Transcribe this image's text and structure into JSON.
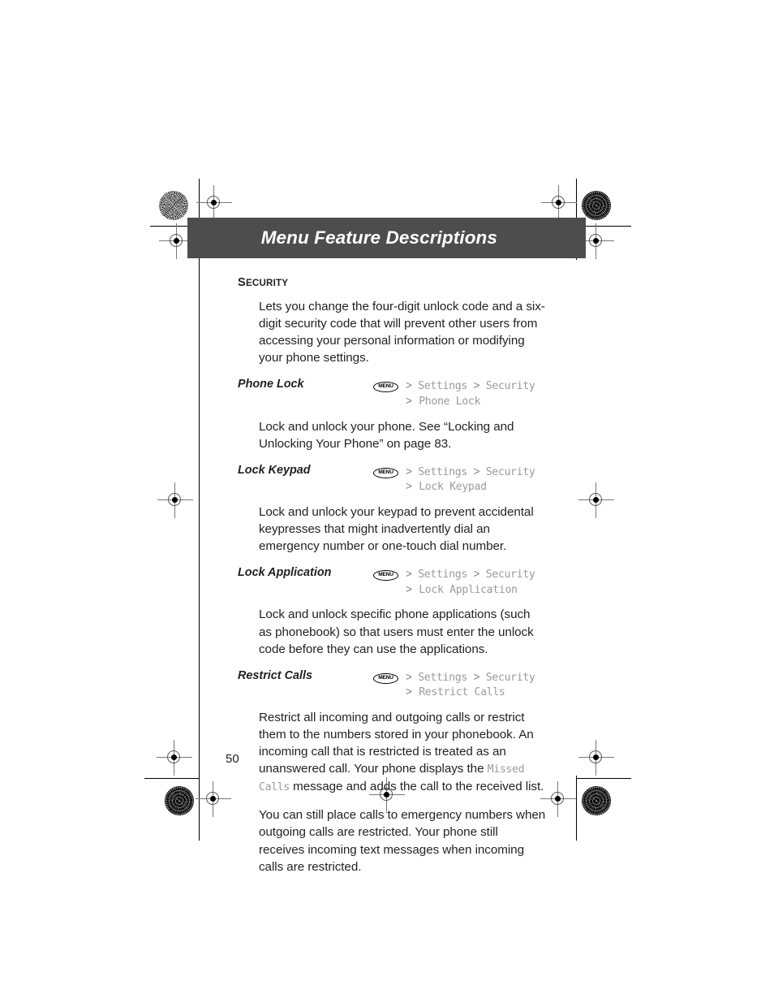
{
  "header": {
    "title": "Menu Feature Descriptions"
  },
  "section": {
    "heading_first_letter": "S",
    "heading_rest": "ECURITY",
    "intro": "Lets you change the four-digit unlock code and a six-digit security code that will prevent other users from accessing your personal information or modifying your phone settings."
  },
  "menu_chip_label": "MENU",
  "separator": ">",
  "features": [
    {
      "term": "Phone Lock",
      "path_line1_a": "Settings",
      "path_line1_b": "Security",
      "path_line2": "Phone Lock",
      "description": "Lock and unlock your phone. See “Locking and Unlocking Your Phone” on page 83."
    },
    {
      "term": "Lock Keypad",
      "path_line1_a": "Settings",
      "path_line1_b": "Security",
      "path_line2": "Lock Keypad",
      "description": "Lock and unlock your keypad to prevent accidental keypresses that might inadvertently dial an emergency number or one-touch dial number."
    },
    {
      "term": "Lock Application",
      "path_line1_a": "Settings",
      "path_line1_b": "Security",
      "path_line2": "Lock Application",
      "description": "Lock and unlock specific phone applications (such as phonebook) so that users must enter the unlock code before they can use the applications."
    },
    {
      "term": "Restrict Calls",
      "path_line1_a": "Settings",
      "path_line1_b": "Security",
      "path_line2": "Restrict Calls",
      "description_part1": "Restrict all incoming and outgoing calls or restrict them to the numbers stored in your phonebook. An incoming call that is restricted is treated as an unanswered call. Your phone displays the ",
      "description_screen_term": "Missed Calls",
      "description_part2": " message and adds the call to the received list.",
      "description_extra": "You can still place calls to emergency numbers when outgoing calls are restricted. Your phone still receives incoming text messages when incoming calls are restricted."
    }
  ],
  "folio": "50",
  "colors": {
    "header_band": "#4d4d4d",
    "body_text": "#231f20",
    "path_text": "#9b9b9b"
  }
}
